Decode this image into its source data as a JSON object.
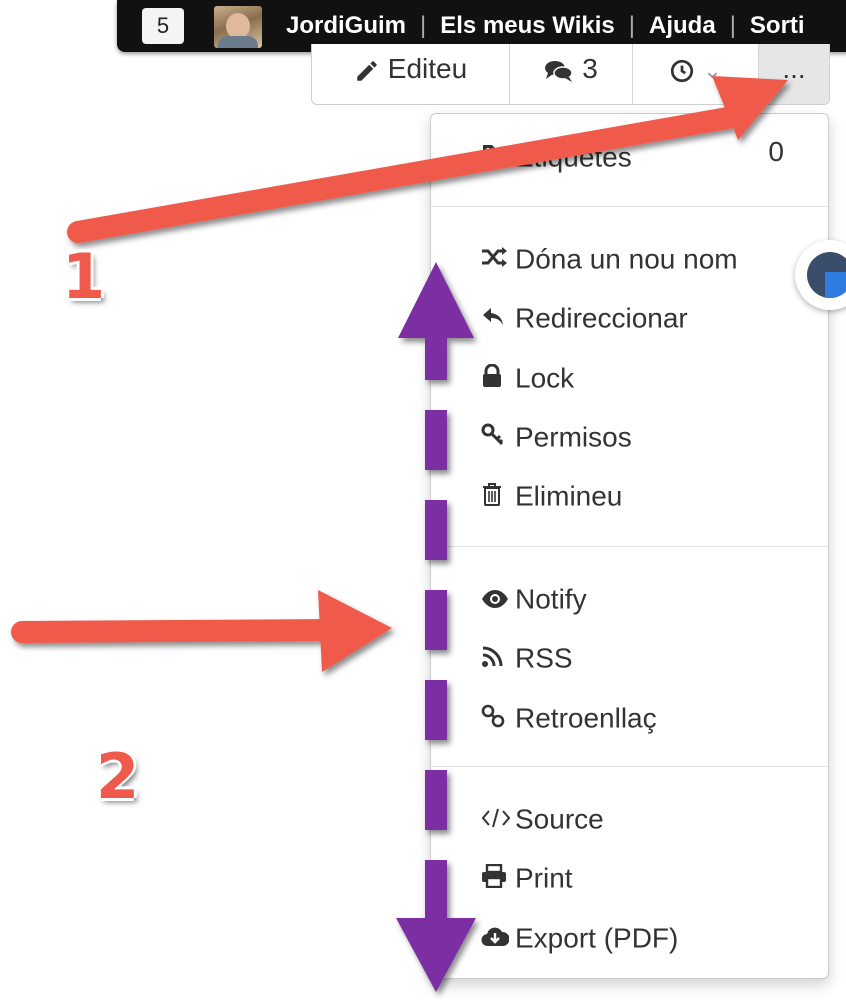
{
  "topbar": {
    "notifications": "5",
    "username": "JordiGuim",
    "my_wikis": "Els meus Wikis",
    "help": "Ajuda",
    "logout": "Sorti"
  },
  "toolbar": {
    "edit_label": "Editeu",
    "comments_count": "3",
    "more_label": "..."
  },
  "dropdown": {
    "tags_label": "Etiquetes",
    "tags_count": "0",
    "items_group1": [
      "Dóna un nou nom",
      "Redireccionar",
      "Lock",
      "Permisos",
      "Elimineu"
    ],
    "items_group2": [
      "Notify",
      "RSS",
      "Retroenllaç"
    ],
    "items_group3": [
      "Source",
      "Print",
      "Export (PDF)"
    ]
  },
  "annotations": {
    "step1": "1",
    "step2": "2"
  },
  "colors": {
    "annotation_arrow": "#ef5a4c",
    "scroll_arrow": "#7b2fa3",
    "topbar_bg": "#111111"
  },
  "icons": [
    "pencil-icon",
    "comments-icon",
    "clock-icon",
    "tag-icon",
    "shuffle-icon",
    "reply-icon",
    "lock-icon",
    "key-icon",
    "trash-icon",
    "eye-icon",
    "rss-icon",
    "link-icon",
    "code-icon",
    "print-icon",
    "cloud-download-icon"
  ]
}
